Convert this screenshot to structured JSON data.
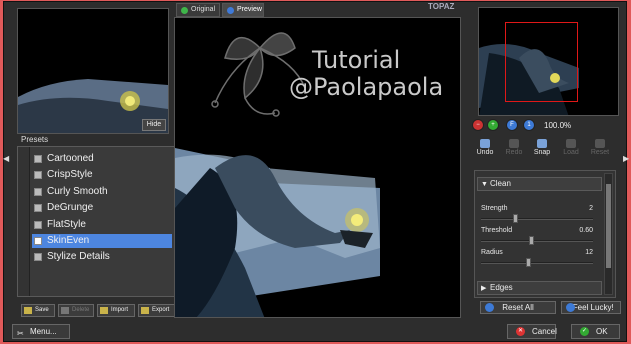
{
  "tabs": [
    {
      "label": "Original",
      "color": "#3fb54a"
    },
    {
      "label": "Preview",
      "color": "#3f7ad8"
    }
  ],
  "watermark": {
    "line1": "Tutorial",
    "line2": "@Paolapaola"
  },
  "logo_text": "TOPAZ",
  "left_panel": {
    "hide_label": "Hide",
    "presets_title": "Presets"
  },
  "presets": [
    {
      "label": "Cartooned"
    },
    {
      "label": "CrispStyle"
    },
    {
      "label": "Curly Smooth"
    },
    {
      "label": "DeGrunge"
    },
    {
      "label": "FlatStyle"
    },
    {
      "label": "SkinEven",
      "selected": true
    },
    {
      "label": "Stylize Details"
    }
  ],
  "preset_buttons": {
    "save": "Save",
    "delete": "Delete",
    "import": "Import",
    "export": "Export"
  },
  "zoom": {
    "value": "100.0%"
  },
  "tools": {
    "undo": "Undo",
    "redo": "Redo",
    "snap": "Snap",
    "load": "Load",
    "reset": "Reset"
  },
  "settings": {
    "clean_label": "Clean",
    "edges_label": "Edges",
    "params": [
      {
        "label": "Strength",
        "value": "2",
        "level": 0.3
      },
      {
        "label": "Threshold",
        "value": "0.60",
        "level": 0.45
      },
      {
        "label": "Radius",
        "value": "12",
        "level": 0.42
      }
    ]
  },
  "actions": {
    "reset_all": "Reset All",
    "lucky": "I Feel Lucky!"
  },
  "footer": {
    "menu": "Menu...",
    "cancel": "Cancel",
    "ok": "OK"
  },
  "colors": {
    "accent": "#4d86e0",
    "nav_rect": "#e01818",
    "selection_bg": "#4d86e0"
  }
}
